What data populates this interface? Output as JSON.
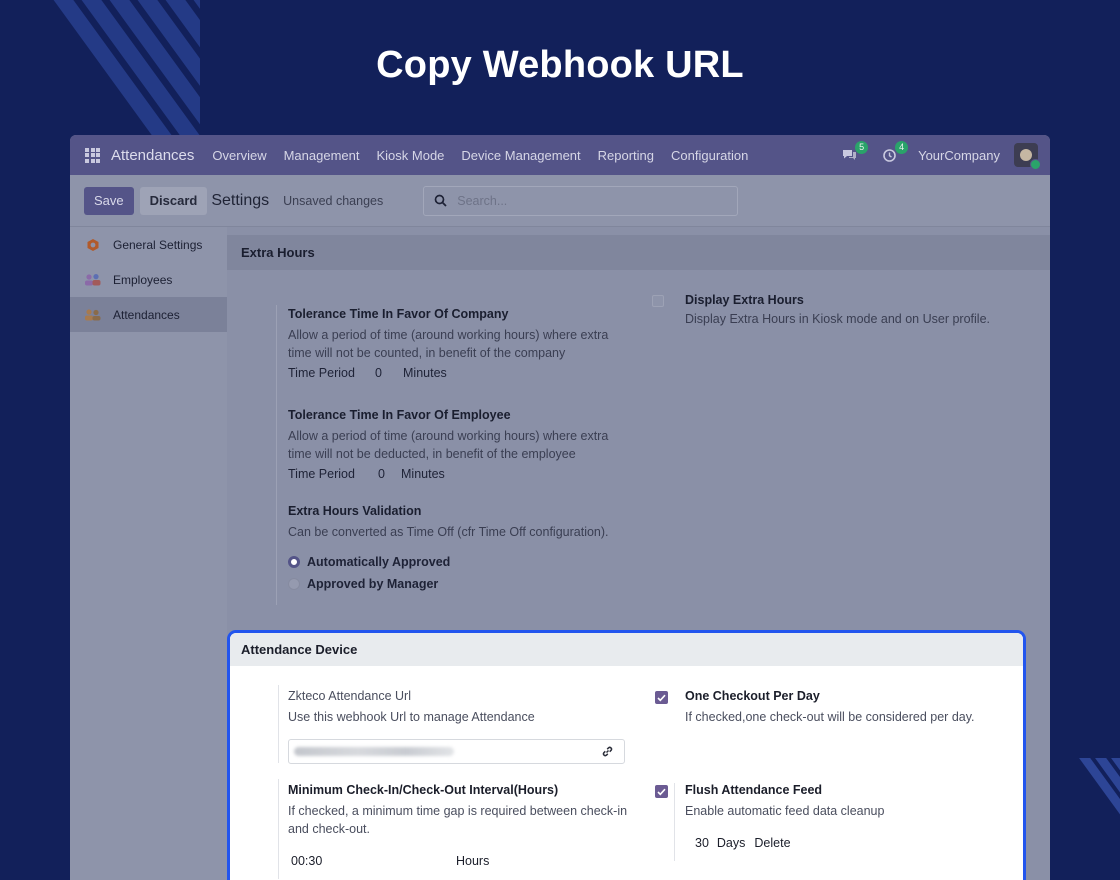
{
  "hero": {
    "title": "Copy Webhook URL"
  },
  "colors": {
    "background": "#12205a",
    "navbar": "#545488",
    "highlight": "#2255ee",
    "checkbox": "#6b5b93",
    "badge": "#2aa36a"
  },
  "navbar": {
    "app_icon": "app-grid-icon",
    "app_name": "Attendances",
    "menu": [
      "Overview",
      "Management",
      "Kiosk Mode",
      "Device Management",
      "Reporting",
      "Configuration"
    ],
    "messages_badge": "5",
    "activities_badge": "4",
    "company": "YourCompany"
  },
  "control_panel": {
    "save_label": "Save",
    "discard_label": "Discard",
    "title": "Settings",
    "status": "Unsaved changes",
    "search_placeholder": "Search..."
  },
  "sidebar": {
    "items": [
      {
        "label": "General Settings",
        "icon": "odoo-logo-icon"
      },
      {
        "label": "Employees",
        "icon": "employees-icon"
      },
      {
        "label": "Attendances",
        "icon": "attendances-icon"
      }
    ]
  },
  "extra_hours": {
    "section_title": "Extra Hours",
    "company_tolerance": {
      "title": "Tolerance Time In Favor Of Company",
      "desc1": "Allow a period of time (around working hours) where extra",
      "desc2": "time will not be counted, in benefit of the company",
      "period_label": "Time Period",
      "value": "0",
      "unit": "Minutes"
    },
    "employee_tolerance": {
      "title": "Tolerance Time In Favor Of Employee",
      "desc1": "Allow a period of time (around working hours) where extra",
      "desc2": "time will not be deducted, in benefit of the employee",
      "period_label": "Time Period",
      "value": "0",
      "unit": "Minutes"
    },
    "validation": {
      "title": "Extra Hours Validation",
      "desc": "Can be converted as Time Off (cfr Time Off configuration).",
      "options": [
        "Automatically Approved",
        "Approved by Manager"
      ],
      "selected": "Automatically Approved"
    },
    "display": {
      "title": "Display Extra Hours",
      "desc": "Display Extra Hours in Kiosk mode and on User profile.",
      "checked": false
    }
  },
  "attendance_device": {
    "section_title": "Attendance Device",
    "zkteco": {
      "title": "Zkteco Attendance Url",
      "desc": "Use this webhook Url to manage Attendance"
    },
    "one_checkout": {
      "title": "One Checkout Per Day",
      "desc": "If checked,one check-out will be considered per day.",
      "checked": true
    },
    "min_interval": {
      "title": "Minimum Check-In/Check-Out Interval(Hours)",
      "desc1": "If checked, a minimum time gap is required between check-in",
      "desc2": "and check-out.",
      "value": "00:30",
      "unit": "Hours"
    },
    "flush_feed": {
      "title": "Flush Attendance Feed",
      "desc": "Enable automatic feed data cleanup",
      "checked": true,
      "value": "30",
      "unit": "Days",
      "action": "Delete"
    }
  }
}
